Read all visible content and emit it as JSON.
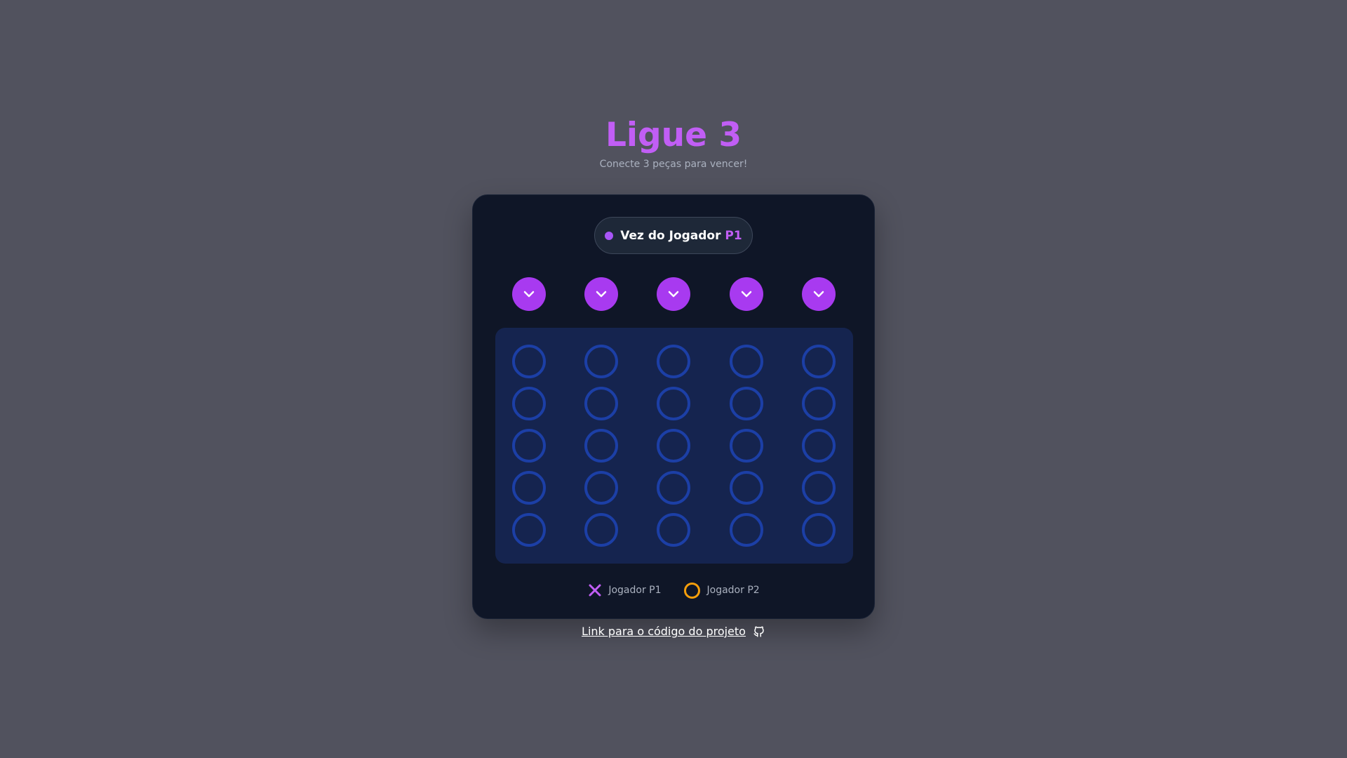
{
  "header": {
    "title": "Ligue 3",
    "subtitle": "Conecte 3 peças para vencer!"
  },
  "turn": {
    "prefix": "Vez do Jogador",
    "player": "P1"
  },
  "board": {
    "columns": 5,
    "rows": 5,
    "cells": [
      [
        "",
        "",
        "",
        "",
        ""
      ],
      [
        "",
        "",
        "",
        "",
        ""
      ],
      [
        "",
        "",
        "",
        "",
        ""
      ],
      [
        "",
        "",
        "",
        "",
        ""
      ],
      [
        "",
        "",
        "",
        "",
        ""
      ]
    ]
  },
  "drop_buttons": [
    {
      "icon": "chevron-down-icon"
    },
    {
      "icon": "chevron-down-icon"
    },
    {
      "icon": "chevron-down-icon"
    },
    {
      "icon": "chevron-down-icon"
    },
    {
      "icon": "chevron-down-icon"
    }
  ],
  "legend": {
    "p1_label": "Jogador P1",
    "p1_icon": "x-icon",
    "p2_label": "Jogador P2",
    "p2_icon": "circle-icon"
  },
  "footer": {
    "link_text": "Link para o código do projeto",
    "link_icon": "github-icon"
  },
  "colors": {
    "background": "#51525e",
    "accent": "#c15ef5",
    "button": "#a83af0",
    "board": "#15244f",
    "cell_ring": "#1c3fa6",
    "p2": "#f59e0b"
  }
}
